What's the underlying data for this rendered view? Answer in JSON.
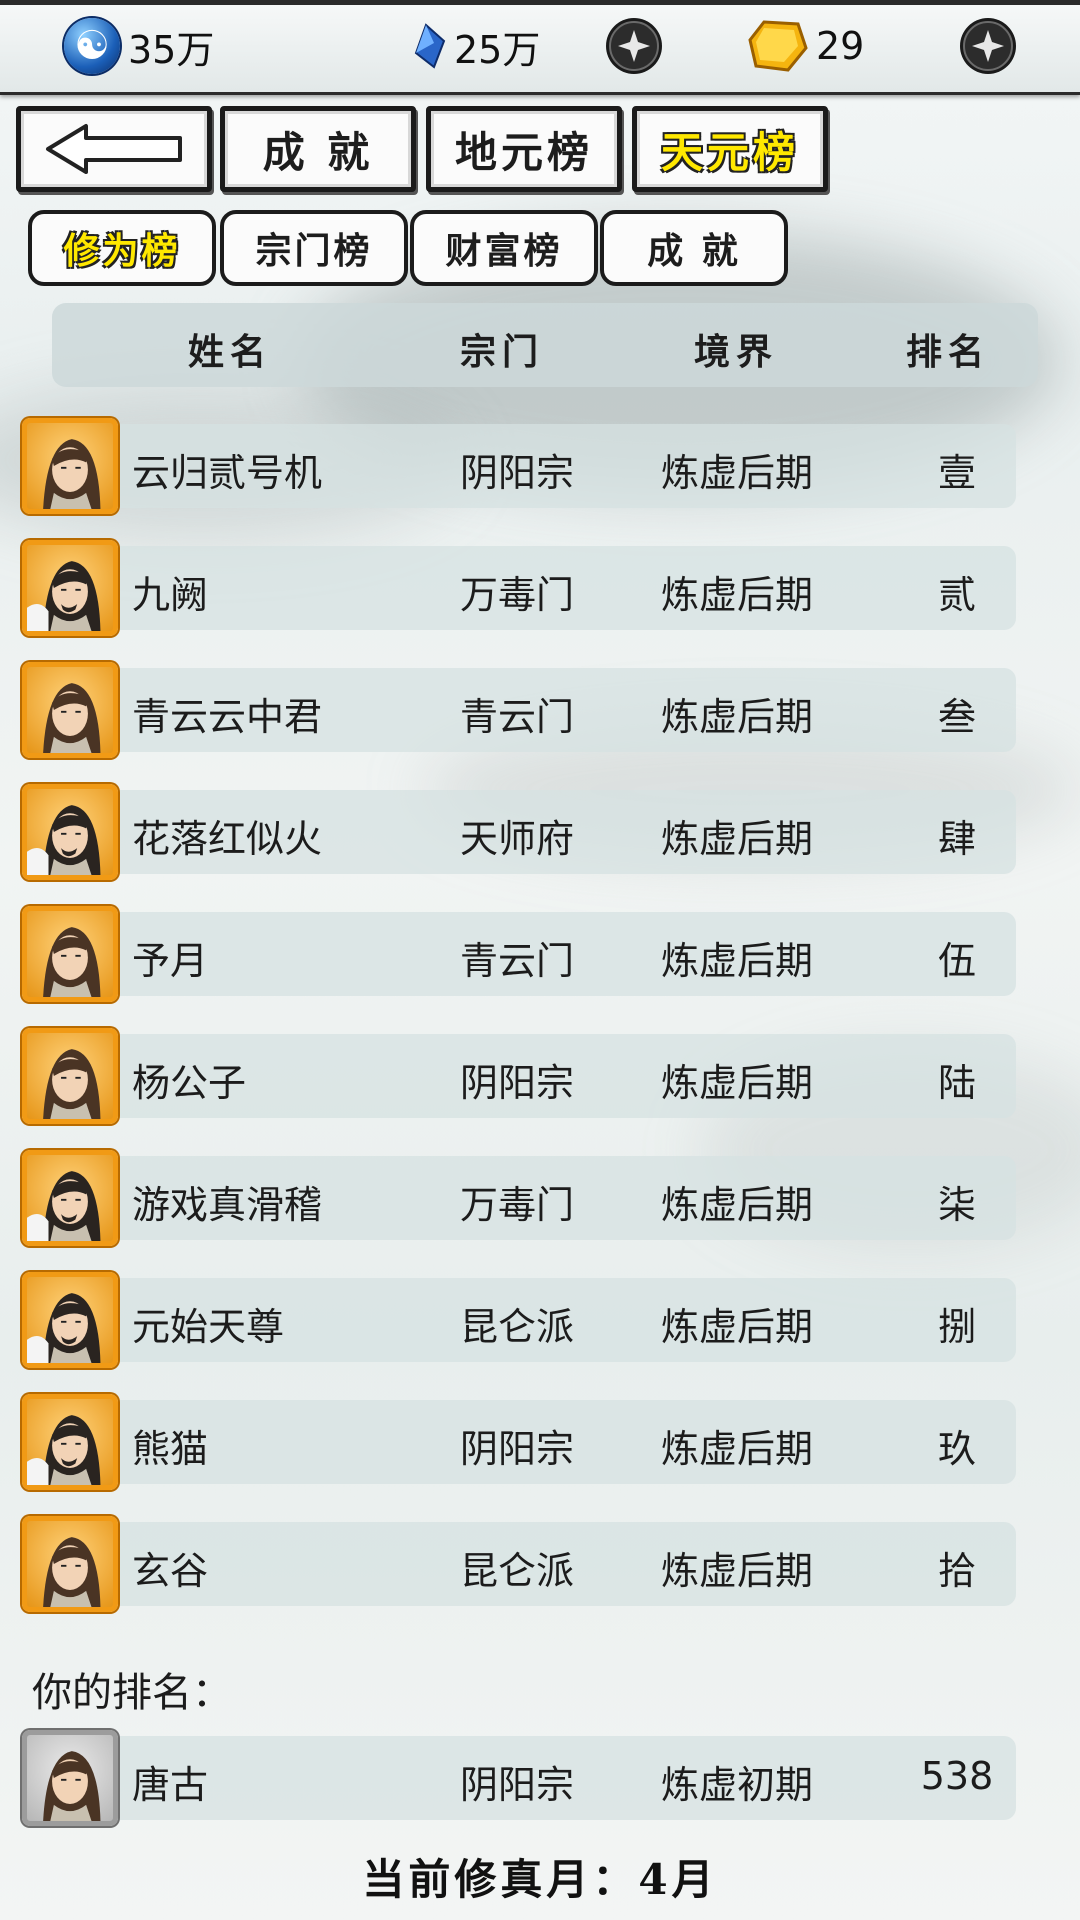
{
  "resources": {
    "spirit": {
      "icon": "yin-yang-icon",
      "value": "35万"
    },
    "gem": {
      "icon": "blue-gem-icon",
      "value": "25万",
      "add_icon": "plus-icon"
    },
    "gold": {
      "icon": "gold-ingot-icon",
      "value": "29",
      "add_icon": "plus-icon"
    }
  },
  "main_tabs": [
    {
      "label": "←",
      "icon": "back-arrow-icon",
      "active": false
    },
    {
      "label": "成 就",
      "active": false
    },
    {
      "label": "地元榜",
      "active": false
    },
    {
      "label": "天元榜",
      "active": true
    }
  ],
  "sub_tabs": [
    {
      "label": "修为榜",
      "active": true
    },
    {
      "label": "宗门榜",
      "active": false
    },
    {
      "label": "财富榜",
      "active": false
    },
    {
      "label": "成 就",
      "active": false
    }
  ],
  "table": {
    "columns": [
      "姓名",
      "宗门",
      "境界",
      "排名"
    ],
    "rows": [
      {
        "name": "云归贰号机",
        "sect": "阴阳宗",
        "realm": "炼虚后期",
        "rank": "壹",
        "avatar": "female"
      },
      {
        "name": "九阙",
        "sect": "万毒门",
        "realm": "炼虚后期",
        "rank": "贰",
        "avatar": "male"
      },
      {
        "name": "青云云中君",
        "sect": "青云门",
        "realm": "炼虚后期",
        "rank": "叁",
        "avatar": "female"
      },
      {
        "name": "花落红似火",
        "sect": "天师府",
        "realm": "炼虚后期",
        "rank": "肆",
        "avatar": "male"
      },
      {
        "name": "予月",
        "sect": "青云门",
        "realm": "炼虚后期",
        "rank": "伍",
        "avatar": "female"
      },
      {
        "name": "杨公子",
        "sect": "阴阳宗",
        "realm": "炼虚后期",
        "rank": "陆",
        "avatar": "female"
      },
      {
        "name": "游戏真滑稽",
        "sect": "万毒门",
        "realm": "炼虚后期",
        "rank": "柒",
        "avatar": "male"
      },
      {
        "name": "元始天尊",
        "sect": "昆仑派",
        "realm": "炼虚后期",
        "rank": "捌",
        "avatar": "male"
      },
      {
        "name": "熊猫",
        "sect": "阴阳宗",
        "realm": "炼虚后期",
        "rank": "玖",
        "avatar": "male"
      },
      {
        "name": "玄谷",
        "sect": "昆仑派",
        "realm": "炼虚后期",
        "rank": "拾",
        "avatar": "female"
      }
    ]
  },
  "my_rank": {
    "label": "你的排名：",
    "name": "唐古",
    "sect": "阴阳宗",
    "realm": "炼虚初期",
    "rank": "538",
    "avatar": "female"
  },
  "footer": "当前修真月：4月",
  "colors": {
    "active_tab_text": "#ffe800",
    "avatar_frame": "#f19a15",
    "frame_dark": "#1b1b1b"
  }
}
